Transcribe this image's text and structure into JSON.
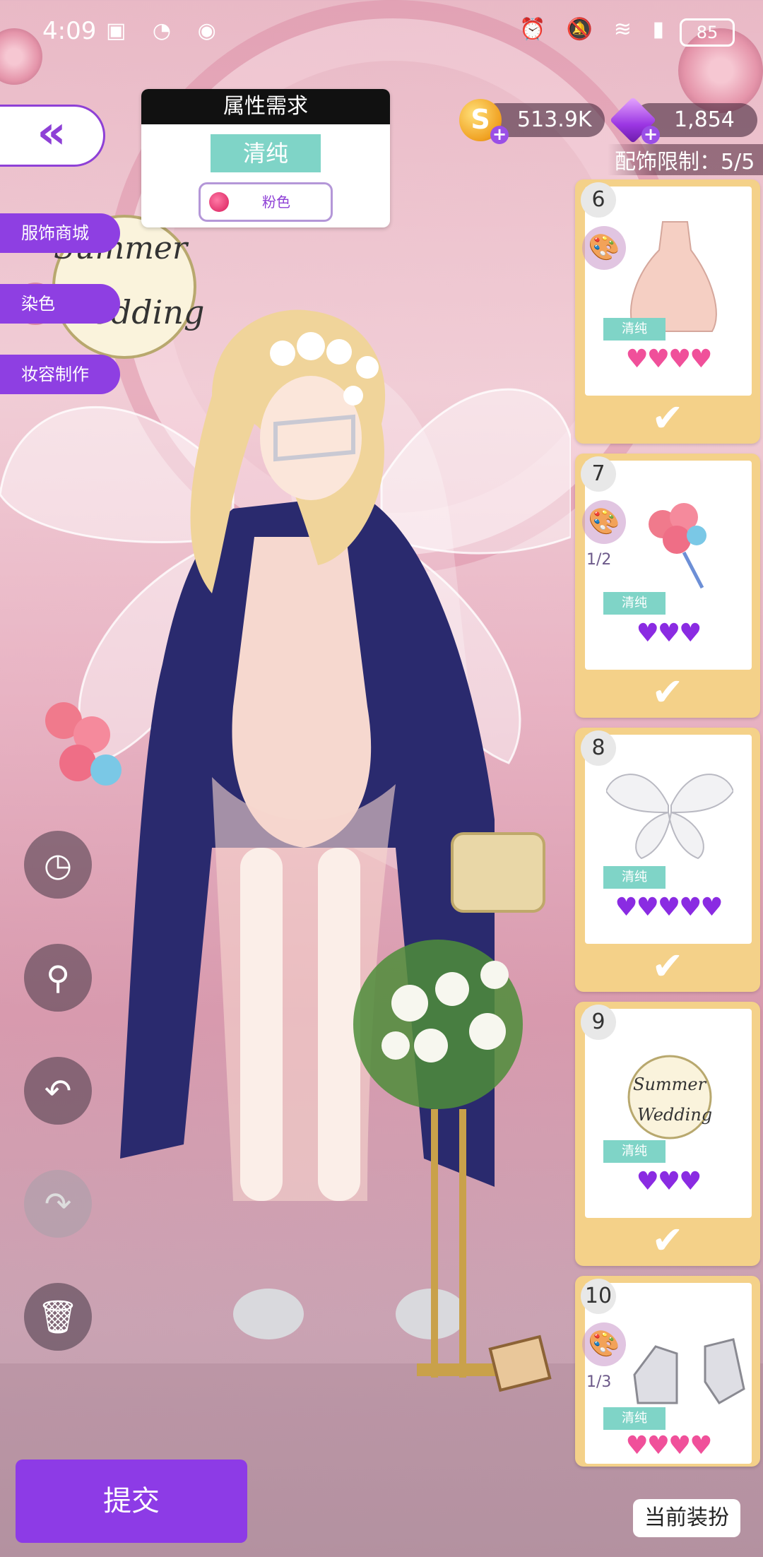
{
  "status_bar": {
    "time": "4:09",
    "battery": "85"
  },
  "requirement": {
    "title": "属性需求",
    "tag": "清纯",
    "color": "粉色"
  },
  "currency": {
    "coins": "513.9K",
    "gems": "1,854"
  },
  "accessory_limit": "配饰限制：5/5",
  "side_menu": [
    "服饰商城",
    "染色",
    "妆容制作"
  ],
  "badge_text": {
    "line1": "Summer",
    "line2": "Wedding"
  },
  "items": [
    {
      "num": "6",
      "tag": "清纯",
      "hearts": "♥♥♥♥",
      "heart_color": "#f0509a",
      "dye": "",
      "icon": "dress-icon"
    },
    {
      "num": "7",
      "tag": "清纯",
      "hearts": "♥♥♥",
      "heart_color": "#8a2be2",
      "dye": "1/2",
      "icon": "bouquet-icon"
    },
    {
      "num": "8",
      "tag": "清纯",
      "hearts": "♥♥♥♥♥",
      "heart_color": "#8a2be2",
      "dye": "",
      "icon": "wings-icon"
    },
    {
      "num": "9",
      "tag": "清纯",
      "hearts": "♥♥♥",
      "heart_color": "#8a2be2",
      "dye": "",
      "icon": "summer-wedding-badge-icon"
    },
    {
      "num": "10",
      "tag": "清纯",
      "hearts": "♥♥♥♥",
      "heart_color": "#f0509a",
      "dye": "1/3",
      "icon": "shoes-icon"
    }
  ],
  "actions": [
    "history-icon",
    "zoom-icon",
    "undo-icon",
    "redo-icon",
    "trash-icon"
  ],
  "buttons": {
    "submit": "提交",
    "current_outfit": "当前装扮"
  },
  "colors": {
    "accent_purple": "#8d3be6",
    "tag_teal": "#7fd4c7",
    "card_gold": "#f4d189"
  }
}
